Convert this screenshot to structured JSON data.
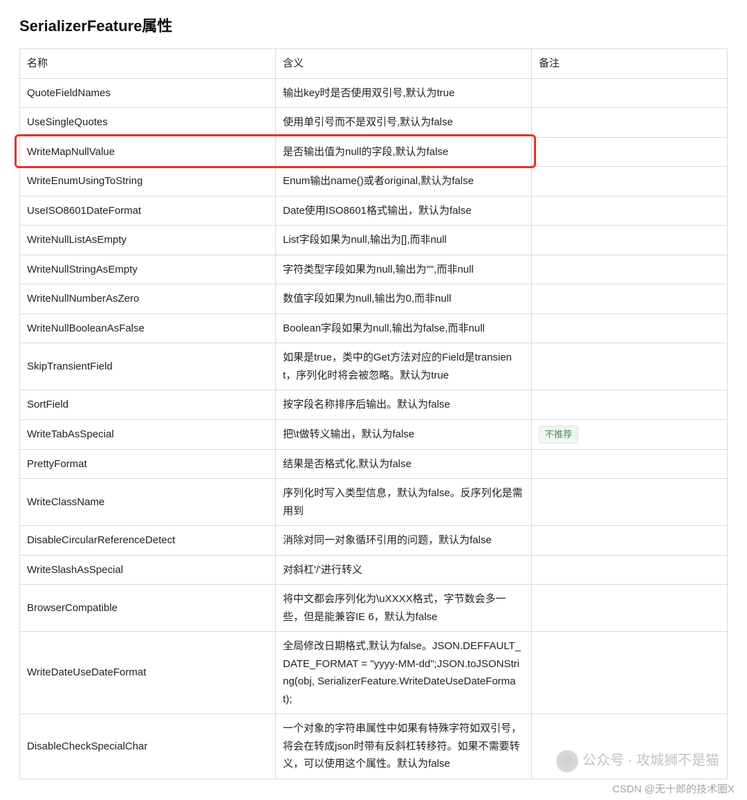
{
  "title": "SerializerFeature属性",
  "columns": {
    "name": "名称",
    "desc": "含义",
    "remark": "备注"
  },
  "rows": [
    {
      "name": "QuoteFieldNames",
      "desc": "输出key时是否使用双引号,默认为true",
      "remark": ""
    },
    {
      "name": "UseSingleQuotes",
      "desc": "使用单引号而不是双引号,默认为false",
      "remark": ""
    },
    {
      "name": "WriteMapNullValue",
      "desc": "是否输出值为null的字段,默认为false",
      "remark": "",
      "highlight": true
    },
    {
      "name": "WriteEnumUsingToString",
      "desc": "Enum输出name()或者original,默认为false",
      "remark": ""
    },
    {
      "name": "UseISO8601DateFormat",
      "desc": "Date使用ISO8601格式输出，默认为false",
      "remark": ""
    },
    {
      "name": "WriteNullListAsEmpty",
      "desc": "List字段如果为null,输出为[],而非null",
      "remark": ""
    },
    {
      "name": "WriteNullStringAsEmpty",
      "desc": "字符类型字段如果为null,输出为\"\",而非null",
      "remark": ""
    },
    {
      "name": "WriteNullNumberAsZero",
      "desc": "数值字段如果为null,输出为0,而非null",
      "remark": ""
    },
    {
      "name": "WriteNullBooleanAsFalse",
      "desc": "Boolean字段如果为null,输出为false,而非null",
      "remark": ""
    },
    {
      "name": "SkipTransientField",
      "desc": "如果是true，类中的Get方法对应的Field是transient，序列化时将会被忽略。默认为true",
      "remark": ""
    },
    {
      "name": "SortField",
      "desc": "按字段名称排序后输出。默认为false",
      "remark": ""
    },
    {
      "name": "WriteTabAsSpecial",
      "desc": "把\\t做转义输出，默认为false",
      "remark_badge": "不推荐"
    },
    {
      "name": "PrettyFormat",
      "desc": "结果是否格式化,默认为false",
      "remark": ""
    },
    {
      "name": "WriteClassName",
      "desc": "序列化时写入类型信息，默认为false。反序列化是需用到",
      "remark": ""
    },
    {
      "name": "DisableCircularReferenceDetect",
      "desc": "消除对同一对象循环引用的问题，默认为false",
      "remark": ""
    },
    {
      "name": "WriteSlashAsSpecial",
      "desc": "对斜杠'/'进行转义",
      "remark": ""
    },
    {
      "name": "BrowserCompatible",
      "desc": "将中文都会序列化为\\uXXXX格式，字节数会多一些，但是能兼容IE 6，默认为false",
      "remark": ""
    },
    {
      "name": "WriteDateUseDateFormat",
      "desc": "全局修改日期格式,默认为false。JSON.DEFFAULT_DATE_FORMAT = \"yyyy-MM-dd\";JSON.toJSONString(obj, SerializerFeature.WriteDateUseDateFormat);",
      "remark": ""
    },
    {
      "name": "DisableCheckSpecialChar",
      "desc": "一个对象的字符串属性中如果有特殊字符如双引号，将会在转成json时带有反斜杠转移符。如果不需要转义，可以使用这个属性。默认为false",
      "remark": ""
    }
  ],
  "watermark_text": "公众号 · 攻城狮不是猫",
  "footer_credit": "CSDN @无十郎的技术圈X"
}
